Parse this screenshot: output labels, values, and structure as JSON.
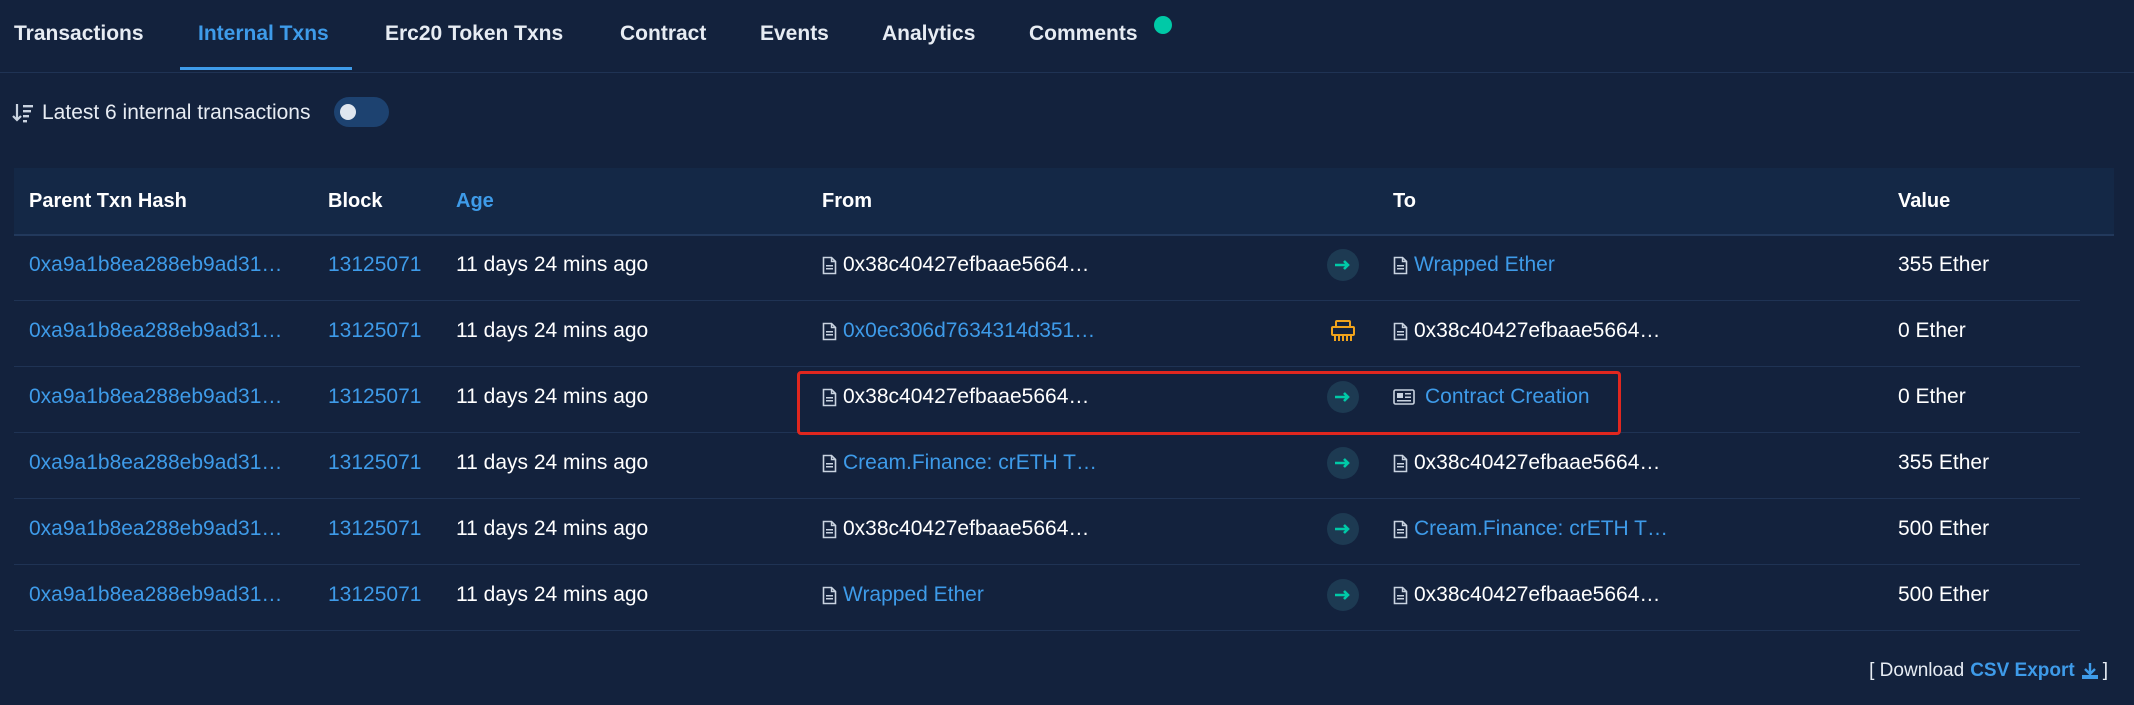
{
  "tabs": [
    {
      "label": "Transactions"
    },
    {
      "label": "Internal Txns"
    },
    {
      "label": "Erc20 Token Txns"
    },
    {
      "label": "Contract"
    },
    {
      "label": "Events"
    },
    {
      "label": "Analytics"
    },
    {
      "label": "Comments"
    }
  ],
  "active_tab": "Internal Txns",
  "summary": {
    "text": "Latest 6 internal transactions",
    "toggle_on": false
  },
  "columns": {
    "parent_txn_hash": "Parent Txn Hash",
    "block": "Block",
    "age": "Age",
    "from": "From",
    "to": "To",
    "value": "Value"
  },
  "rows": [
    {
      "hash": "0xa9a1b8ea288eb9ad31…",
      "block": "13125071",
      "age": "11 days 24 mins ago",
      "from": "0x38c40427efbaae5664…",
      "from_link": false,
      "direction": "arrow",
      "to": "Wrapped Ether",
      "to_link": true,
      "to_icon": "doc-icon",
      "value": "355 Ether"
    },
    {
      "hash": "0xa9a1b8ea288eb9ad31…",
      "block": "13125071",
      "age": "11 days 24 mins ago",
      "from": "0x0ec306d7634314d351…",
      "from_link": true,
      "direction": "tool",
      "to": "0x38c40427efbaae5664…",
      "to_link": false,
      "to_icon": "doc-icon",
      "value": "0 Ether"
    },
    {
      "hash": "0xa9a1b8ea288eb9ad31…",
      "block": "13125071",
      "age": "11 days 24 mins ago",
      "from": "0x38c40427efbaae5664…",
      "from_link": false,
      "direction": "arrow",
      "to": "Contract Creation",
      "to_link": true,
      "to_icon": "contract-creation-icon",
      "value": "0 Ether"
    },
    {
      "hash": "0xa9a1b8ea288eb9ad31…",
      "block": "13125071",
      "age": "11 days 24 mins ago",
      "from": "Cream.Finance: crETH T…",
      "from_link": true,
      "direction": "arrow",
      "to": "0x38c40427efbaae5664…",
      "to_link": false,
      "to_icon": "doc-icon",
      "value": "355 Ether"
    },
    {
      "hash": "0xa9a1b8ea288eb9ad31…",
      "block": "13125071",
      "age": "11 days 24 mins ago",
      "from": "0x38c40427efbaae5664…",
      "from_link": false,
      "direction": "arrow",
      "to": "Cream.Finance: crETH T…",
      "to_link": true,
      "to_icon": "doc-icon",
      "value": "500 Ether"
    },
    {
      "hash": "0xa9a1b8ea288eb9ad31…",
      "block": "13125071",
      "age": "11 days 24 mins ago",
      "from": "Wrapped Ether",
      "from_link": true,
      "direction": "arrow",
      "to": "0x38c40427efbaae5664…",
      "to_link": false,
      "to_icon": "doc-icon",
      "value": "500 Ether"
    }
  ],
  "footer": {
    "prefix": "[ Download",
    "csv": "CSV Export",
    "suffix": "]"
  },
  "colors": {
    "background": "#13223d",
    "link": "#3e9be9",
    "accent": "#00c9a7",
    "highlight": "#e0271f"
  }
}
